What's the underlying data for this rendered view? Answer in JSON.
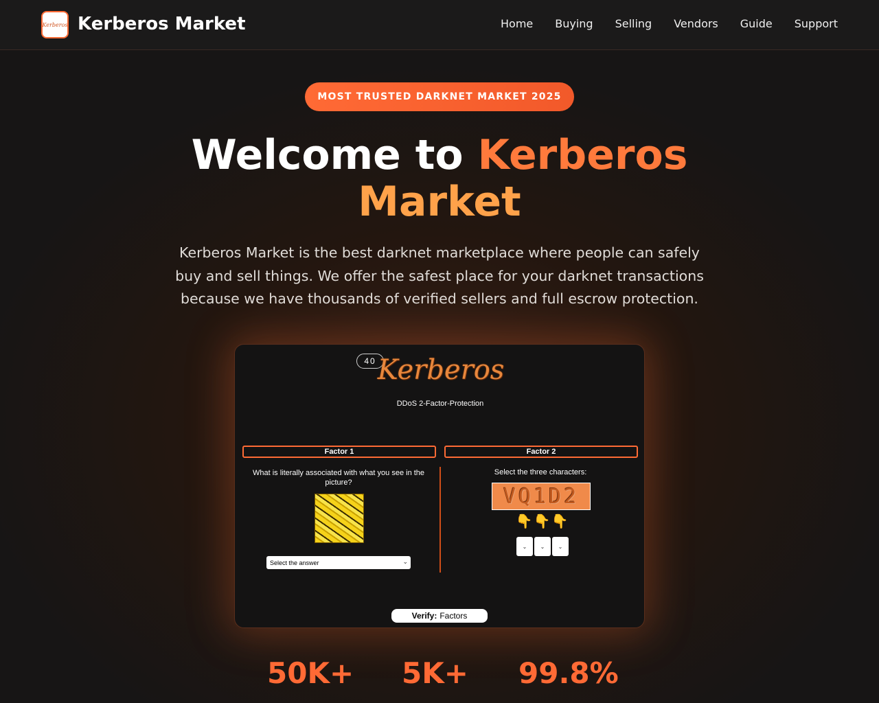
{
  "nav": {
    "logo_text": "Kerberos",
    "brand": "Kerberos Market",
    "links": [
      "Home",
      "Buying",
      "Selling",
      "Vendors",
      "Guide",
      "Support"
    ]
  },
  "hero": {
    "badge": "MOST TRUSTED DARKNET MARKET 2025",
    "title_white": "Welcome to ",
    "title_orange_1": "Kerberos",
    "title_orange_2": "Market",
    "lead": "Kerberos Market is the best darknet marketplace where people can safely buy and sell things. We offer the safest place for your darknet transactions because we have thousands of verified sellers and full escrow protection."
  },
  "captcha_screen": {
    "timer": "40",
    "logo_text": "Kerberos",
    "subtitle": "DDoS 2-Factor-Protection",
    "factor1": {
      "title": "Factor 1",
      "question": "What is literally associated with what you see in the picture?",
      "select_placeholder": "Select the answer"
    },
    "factor2": {
      "title": "Factor 2",
      "instruction": "Select the three characters:",
      "captcha_text": "VQ1D2"
    },
    "verify_bold": "Verify:",
    "verify_rest": "Factors"
  },
  "stats": [
    "50K+",
    "5K+",
    "99.8%"
  ],
  "colors": {
    "accent": "#ff6b35",
    "bg": "#161515"
  }
}
